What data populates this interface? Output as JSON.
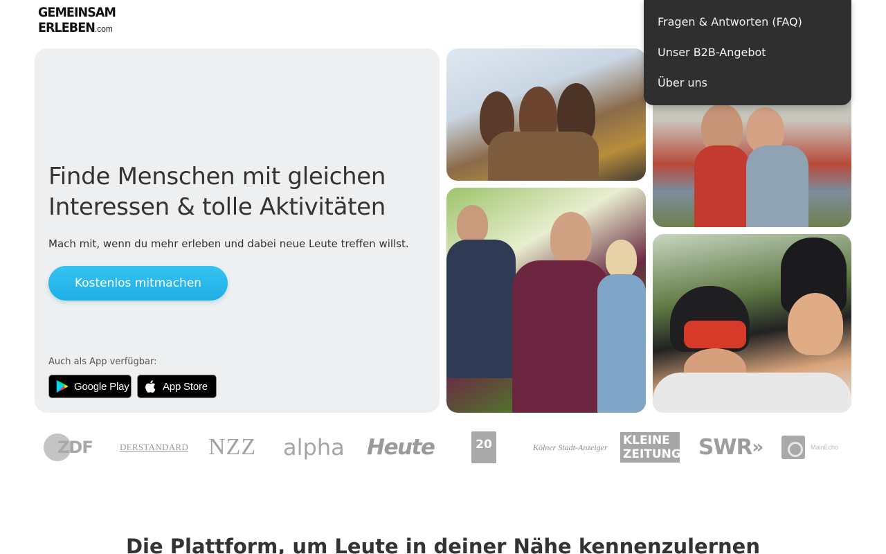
{
  "logo": {
    "line1": "GEMEINSAM",
    "line2": "ERLEBEN",
    "suffix": ".com"
  },
  "menu": {
    "items": [
      {
        "label": "Fragen & Antworten (FAQ)"
      },
      {
        "label": "Unser B2B-Angebot"
      },
      {
        "label": "Über uns"
      }
    ]
  },
  "hero": {
    "title": "Finde Menschen mit gleichen Interessen & tolle Aktivitäten",
    "subtitle": "Mach mit, wenn du mehr erleben und dabei neue Leute treffen willst.",
    "cta_label": "Kostenlos mitmachen",
    "app_label": "Auch als App verfügbar:",
    "google_play_label": "Google Play",
    "app_store_label": "App Store"
  },
  "photos": [
    {
      "alt": "friends-cheering-photo"
    },
    {
      "alt": "couple-dancing-photo"
    },
    {
      "alt": "hikers-in-forest-photo"
    },
    {
      "alt": "mountain-bikers-selfie-photo"
    }
  ],
  "press": {
    "zdf": "ZDF",
    "standard": "DERSTANDARD",
    "nzz": "NZZ",
    "alpha": "alpha",
    "heute": "Heute",
    "twenty": "20",
    "ksa": "Kölner Stadt-Anzeiger",
    "kleine_1": "KLEINE",
    "kleine_2": "ZEITUNG",
    "swr": "SWR",
    "main": "MainEcho"
  },
  "section": {
    "title": "Die Plattform, um Leute in deiner Nähe kennenzulernen"
  },
  "colors": {
    "accent": "#2bb8ec",
    "menu_bg": "#2f2f2f",
    "hero_bg": "#eeeff0"
  }
}
